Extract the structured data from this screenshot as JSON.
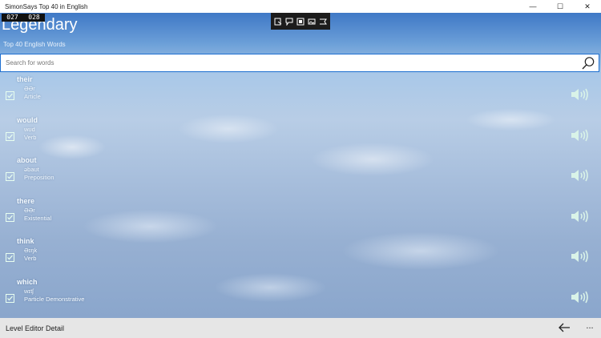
{
  "window": {
    "title": "SimonSays Top 40 in English",
    "minimize": "—",
    "maximize": "☐",
    "close": "✕"
  },
  "counter": {
    "left": "027",
    "right": "028"
  },
  "header": {
    "title": "Legendary",
    "subtitle": "Top 40 English Words"
  },
  "toolbar_icons": [
    "select-icon",
    "comment-icon",
    "frame-icon",
    "image-icon",
    "flag-icon"
  ],
  "search": {
    "placeholder": "Search for words",
    "value": ""
  },
  "words": [
    {
      "word": "their",
      "phonetic": "ƏƏr",
      "pos": "Article",
      "checked": true
    },
    {
      "word": "would",
      "phonetic": "wʊd",
      "pos": "Verb",
      "checked": true
    },
    {
      "word": "about",
      "phonetic": "əbaʊt",
      "pos": "Preposition",
      "checked": true
    },
    {
      "word": "there",
      "phonetic": "ƏƏr",
      "pos": "Existential",
      "checked": true
    },
    {
      "word": "think",
      "phonetic": "Əɪŋk",
      "pos": "Verb",
      "checked": true
    },
    {
      "word": "which",
      "phonetic": "wɪtʃ",
      "pos": "Particle Demonstrative",
      "checked": true
    }
  ],
  "bottombar": {
    "label": "Level Editor Detail",
    "more": "..."
  },
  "colors": {
    "accent": "#1e6fd0",
    "speaker": "#d9f3e8",
    "check": "#e8fff0"
  }
}
